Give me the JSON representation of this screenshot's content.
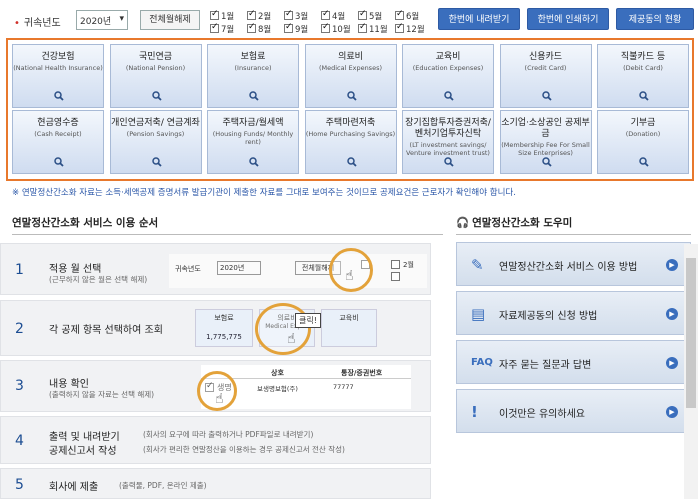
{
  "topbar": {
    "year_label": "귀속년도",
    "year_value": "2020년",
    "unselect_btn": "전체월해제",
    "months": [
      "1월",
      "2월",
      "3월",
      "4월",
      "5월",
      "6월",
      "7월",
      "8월",
      "9월",
      "10월",
      "11월",
      "12월"
    ],
    "download_btn": "한번에 내려받기",
    "print_btn": "한번에 인쇄하기",
    "provider_btn": "제공동의 현황"
  },
  "categories": [
    {
      "ko": "건강보험",
      "en": "(National Health Insurance)"
    },
    {
      "ko": "국민연금",
      "en": "(National Pension)"
    },
    {
      "ko": "보험료",
      "en": "(Insurance)"
    },
    {
      "ko": "의료비",
      "en": "(Medical Expenses)"
    },
    {
      "ko": "교육비",
      "en": "(Education Expenses)"
    },
    {
      "ko": "신용카드",
      "en": "(Credit Card)"
    },
    {
      "ko": "직불카드 등",
      "en": "(Debit Card)"
    },
    {
      "ko": "현금영수증",
      "en": "(Cash Receipt)"
    },
    {
      "ko": "개인연금저축/ 연금계좌",
      "en": "(Pension Savings)"
    },
    {
      "ko": "주택자금/월세액",
      "en": "(Housing Funds/ Monthly rent)"
    },
    {
      "ko": "주택마련저축",
      "en": "(Home Purchasing Savings)"
    },
    {
      "ko": "장기집합투자증권저축/ 벤처기업투자신탁",
      "en": "(LT investment savings/ Venture investment trust)"
    },
    {
      "ko": "소기업·소상공인 공제부금",
      "en": "(Membership Fee For Small Size Enterprises)"
    },
    {
      "ko": "기부금",
      "en": "(Donation)"
    }
  ],
  "notice": "※ 연말정산간소화 자료는 소득·세액공제 증명서류 발급기관이 제출한 자료를 그대로 보여주는 것이므로 공제요건은 근로자가 확인해야 합니다.",
  "guide": {
    "title": "연말정산간소화 서비스 이용 순서",
    "steps": [
      {
        "num": "1",
        "title": "적용 월 선택",
        "sub": "(근무하지 않은 월은 선택 해제)"
      },
      {
        "num": "2",
        "title": "각 공제 항목 선택하여 조회",
        "sub": ""
      },
      {
        "num": "3",
        "title": "내용 확인",
        "sub": "(출력하지 않을 자료는 선택 해제)"
      },
      {
        "num": "4",
        "title": "출력 및 내려받기",
        "title2": "공제신고서 작성",
        "sub": "(회사의 요구에 따라 출력하거나 PDF파일로 내려받기)",
        "sub2": "(회사가 편리한 연말정산을 이용하는 경우 공제신고서 전산 작성)"
      },
      {
        "num": "5",
        "title": "회사에 제출",
        "sub": "(출력물, PDF, 온라인 제출)"
      }
    ],
    "demo": {
      "year_label": "귀속년도",
      "year_value": "2020년",
      "unselect": "전체월해제",
      "m1": "1월",
      "m2": "2월",
      "cat1": "보험료",
      "cat2": "의료비",
      "cat3": "교육비",
      "cat2_en": "Medical Expen",
      "amount": "1,775,775",
      "click": "클릭!",
      "col1": "상호",
      "col2": "통장/증권번호",
      "row1": "보생명보험(주)",
      "row1b": "77777",
      "check_label": "생명"
    }
  },
  "helper": {
    "title": "연말정산간소화 도우미",
    "items": [
      {
        "icon": "edit-doc-icon",
        "label": "연말정산간소화 서비스 이용 방법"
      },
      {
        "icon": "doc-icon",
        "label": "자료제공동의 신청 방법"
      },
      {
        "icon": "faq-icon",
        "label": "자주 묻는 질문과 답변",
        "badge": "FAQ"
      },
      {
        "icon": "exclaim-icon",
        "label": "이것만은 유의하세요"
      }
    ]
  },
  "colors": {
    "accent": "#3a6ebd",
    "highlight": "#e8782c",
    "ring": "#e3a23a"
  }
}
